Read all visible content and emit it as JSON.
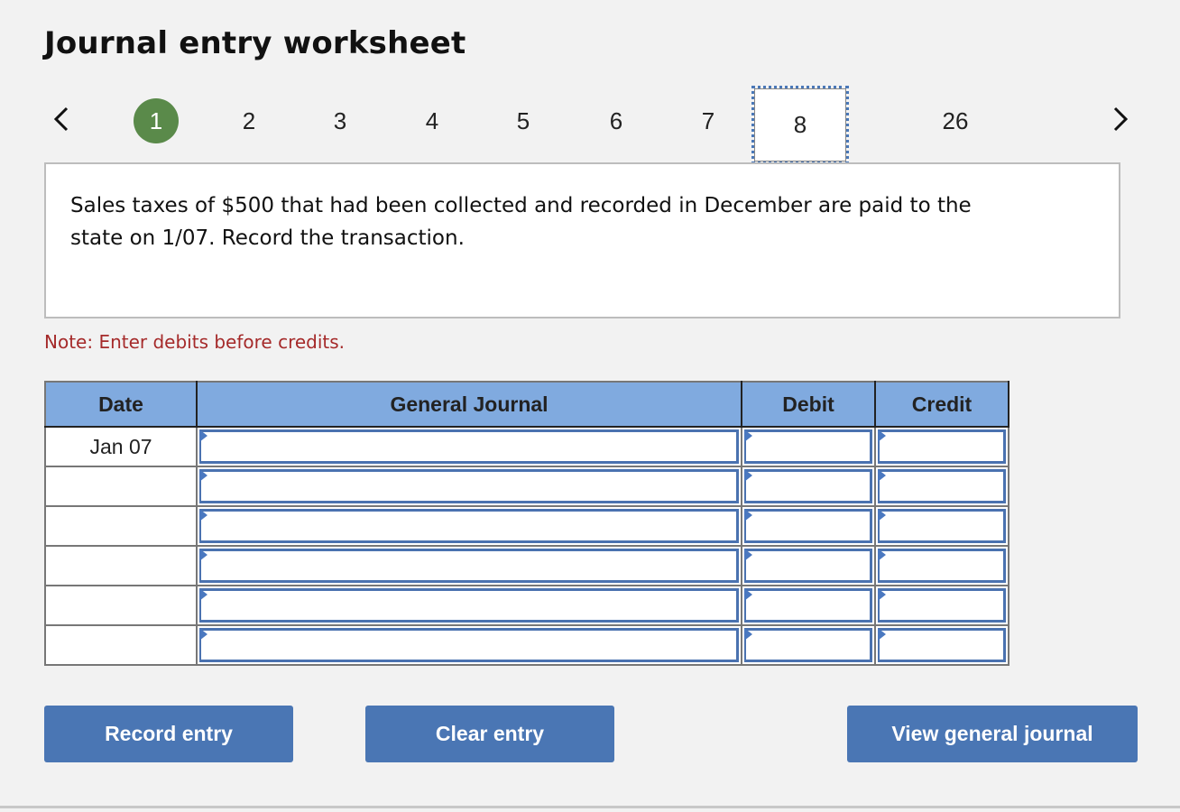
{
  "title": "Journal entry worksheet",
  "pager": {
    "prev_icon": "chevron-left-icon",
    "next_icon": "chevron-right-icon",
    "items": [
      {
        "label": "1",
        "state": "completed"
      },
      {
        "label": "2",
        "state": "default"
      },
      {
        "label": "3",
        "state": "default"
      },
      {
        "label": "4",
        "state": "default"
      },
      {
        "label": "5",
        "state": "default"
      },
      {
        "label": "6",
        "state": "default"
      },
      {
        "label": "7",
        "state": "default"
      },
      {
        "label": "8",
        "state": "current"
      },
      {
        "label": "26",
        "state": "default"
      }
    ],
    "active_color": "#5a8a4a",
    "focus_color": "#4a78b8"
  },
  "question": {
    "text": "Sales taxes of $500 that had been collected and recorded in December are paid to the state on 1/07. Record the transaction."
  },
  "note": "Note: Enter debits before credits.",
  "journal": {
    "headers": {
      "date": "Date",
      "general_journal": "General Journal",
      "debit": "Debit",
      "credit": "Credit"
    },
    "rows": [
      {
        "date": "Jan 07",
        "account": "",
        "debit": "",
        "credit": ""
      },
      {
        "date": "",
        "account": "",
        "debit": "",
        "credit": ""
      },
      {
        "date": "",
        "account": "",
        "debit": "",
        "credit": ""
      },
      {
        "date": "",
        "account": "",
        "debit": "",
        "credit": ""
      },
      {
        "date": "",
        "account": "",
        "debit": "",
        "credit": ""
      },
      {
        "date": "",
        "account": "",
        "debit": "",
        "credit": ""
      }
    ],
    "header_color": "#80aadf"
  },
  "buttons": {
    "record": "Record entry",
    "clear": "Clear entry",
    "view": "View general journal",
    "color": "#4a76b4"
  }
}
